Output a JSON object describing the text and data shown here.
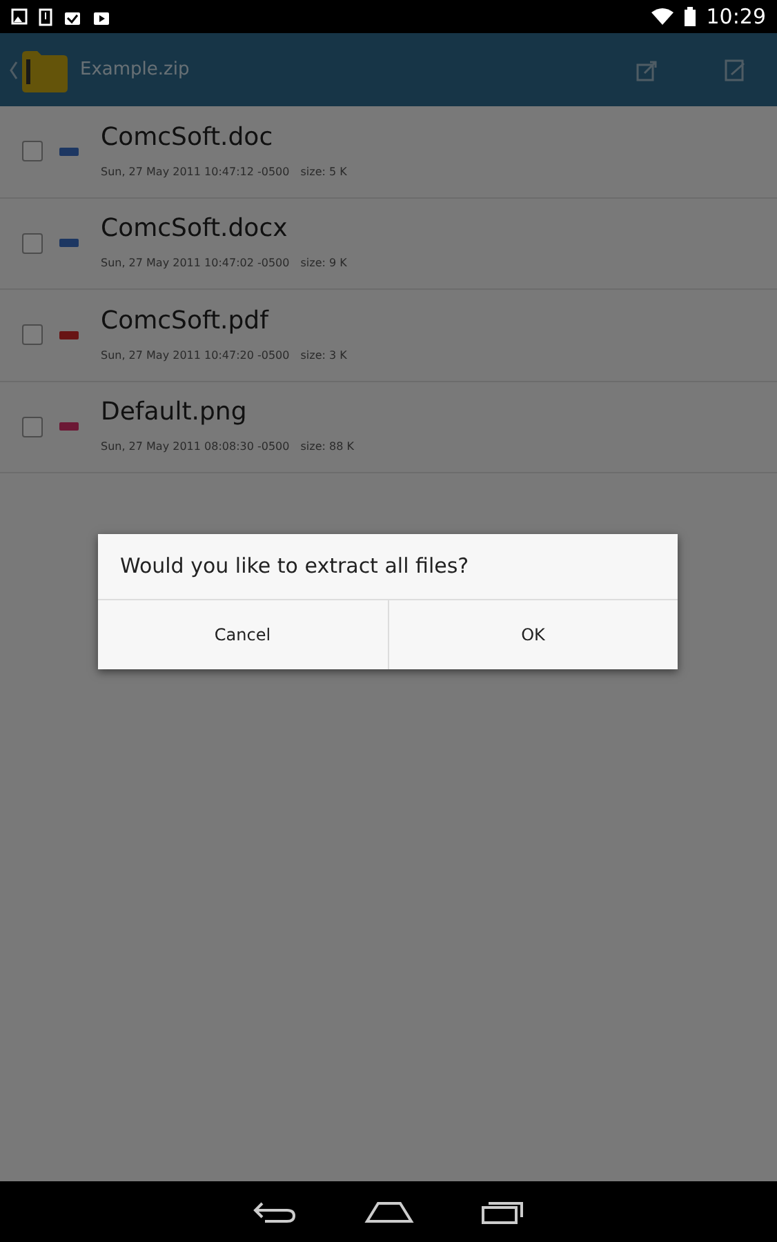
{
  "status_bar": {
    "time": "10:29"
  },
  "app_bar": {
    "title": "Example.zip"
  },
  "files": [
    {
      "name": "ComcSoft.doc",
      "date": "Sun, 27 May 2011 10:47:12 -0500",
      "size": "size: 5 K",
      "checked": false,
      "kind": "doc"
    },
    {
      "name": "ComcSoft.docx",
      "date": "Sun, 27 May 2011 10:47:02 -0500",
      "size": "size: 9 K",
      "checked": false,
      "kind": "doc"
    },
    {
      "name": "ComcSoft.pdf",
      "date": "Sun, 27 May 2011 10:47:20 -0500",
      "size": "size: 3 K",
      "checked": false,
      "kind": "pdf"
    },
    {
      "name": "Default.png",
      "date": "Sun, 27 May 2011 08:08:30 -0500",
      "size": "size: 88 K",
      "checked": false,
      "kind": "image"
    }
  ],
  "dialog": {
    "message": "Would you like to extract all files?",
    "buttons": [
      "Cancel",
      "OK"
    ]
  }
}
